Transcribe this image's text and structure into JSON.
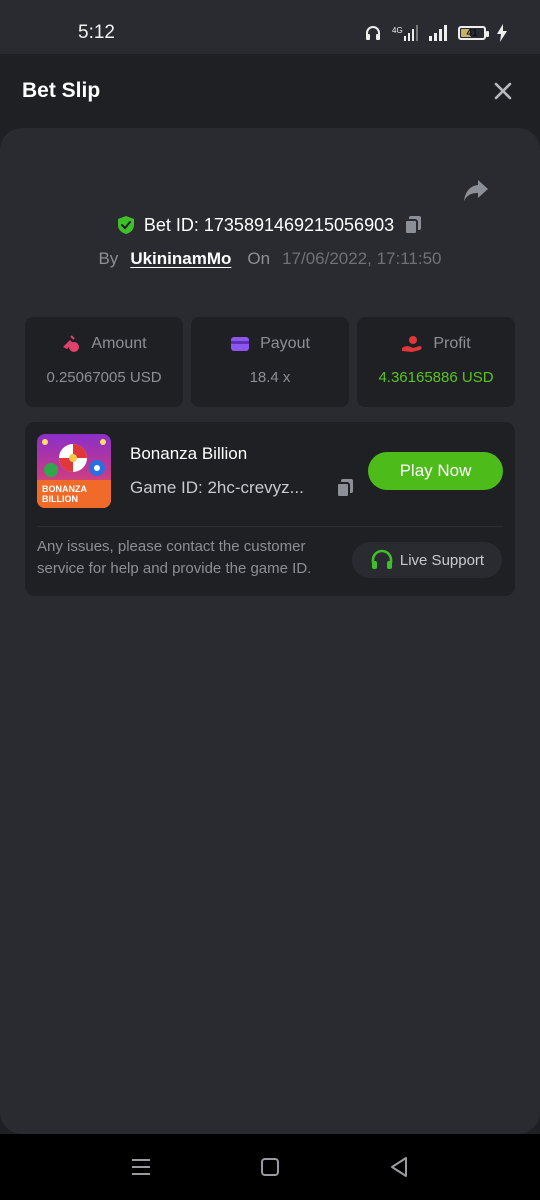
{
  "status_bar": {
    "time": "5:12",
    "battery": "41",
    "icons": [
      "headphones-icon",
      "signal-4g-icon",
      "signal-icon",
      "battery-icon",
      "charging-icon"
    ]
  },
  "header": {
    "title": "Bet Slip",
    "close_icon": "close-icon"
  },
  "bet": {
    "id_text": "Bet ID: 1735891469215056903",
    "by_label": "By",
    "username": "UkininamMo",
    "on_label": "On",
    "date": "17/06/2022, 17:11:50"
  },
  "stats": [
    {
      "label": "Amount",
      "value": "0.25067005 USD",
      "icon": "coins-icon",
      "color": "#e2416d"
    },
    {
      "label": "Payout",
      "value": "18.4 x",
      "icon": "wallet-icon",
      "color": "#8d55f3"
    },
    {
      "label": "Profit",
      "value": "4.36165886 USD",
      "icon": "profit-hand-icon",
      "color": "#e0373a"
    }
  ],
  "game": {
    "name": "Bonanza Billion",
    "id_text": "Game ID: 2hc-crevyz...",
    "thumb_title": "BONANZA BILLION",
    "play_label": "Play Now"
  },
  "support": {
    "issue_text": "Any issues, please contact the customer service for help and provide the game ID.",
    "live_label": "Live Support"
  },
  "colors": {
    "accent_green": "#4dbb19",
    "profit_green": "#58c322",
    "background": "#1f2024",
    "sheet": "#2a2b30"
  }
}
